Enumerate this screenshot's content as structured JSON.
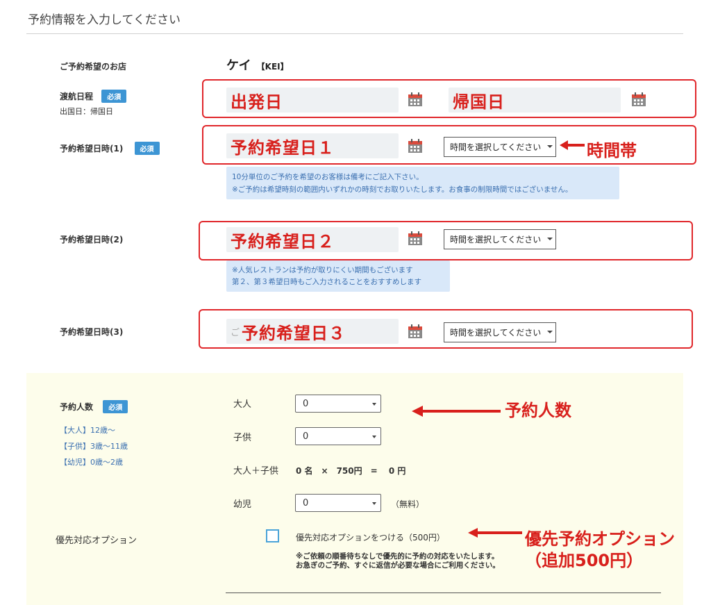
{
  "heading": "予約情報を入力してください",
  "required_badge": "必須",
  "store": {
    "label": "ご予約希望のお店",
    "name": "ケイ",
    "name_en": "【KEI】"
  },
  "travel": {
    "label": "渡航日程",
    "sublabel": "出国日：帰国日",
    "departure": "出発日",
    "return": "帰国日"
  },
  "request1": {
    "label": "予約希望日時(1)",
    "date": "予約希望日１",
    "time": "時間を選択してください",
    "note_lines": [
      "10分単位のご予約を希望のお客様は備考にご記入下さい。",
      "※ご予約は希望時刻の範囲内いずれかの時刻でお取りいたします。お食事の制限時間ではございません。"
    ]
  },
  "request2": {
    "label": "予約希望日時(2)",
    "date": "予約希望日２",
    "time": "時間を選択してください",
    "note_lines": [
      "※人気レストランは予約が取りにくい期間もございます",
      "第２、第３希望日時もご入力されることをおすすめします"
    ]
  },
  "request3": {
    "label": "予約希望日時(3)",
    "placeholder_fragment": "ご",
    "date": "予約希望日３",
    "time": "時間を選択してください"
  },
  "party": {
    "label": "予約人数",
    "age_notes": [
      "【大人】12歳～",
      "【子供】3歳～11歳",
      "【幼児】0歳～2歳"
    ],
    "adult_label": "大人",
    "adult_value": "0",
    "child_label": "子供",
    "child_value": "0",
    "total_label": "大人＋子供",
    "total_formula": "0 名　×　750円　=　 0 円",
    "infant_label": "幼児",
    "infant_value": "0",
    "infant_free": "（無料）"
  },
  "priority": {
    "label": "優先対応オプション",
    "checkbox_label": "優先対応オプションをつける（500円）",
    "checked": false,
    "note_lines": [
      "※ご依頼の順番待ちなしで優先的に予約の対応をいたします。",
      "お急ぎのご予約、すぐに返信が必要な場合にご利用ください。"
    ]
  },
  "annotations": {
    "time_slot": "時間帯",
    "party_size": "予約人数",
    "priority_line1": "優先予約オプション",
    "priority_line2": "（追加500円）"
  },
  "colors": {
    "badge": "#3d95d4",
    "annotation_red": "#d8201c",
    "note_bg": "#d9e8f9",
    "party_bg": "#fdfdeb"
  },
  "icons": {
    "calendar": "calendar-icon",
    "arrow": "arrow-left-icon",
    "dropdown": "chevron-down-icon"
  }
}
